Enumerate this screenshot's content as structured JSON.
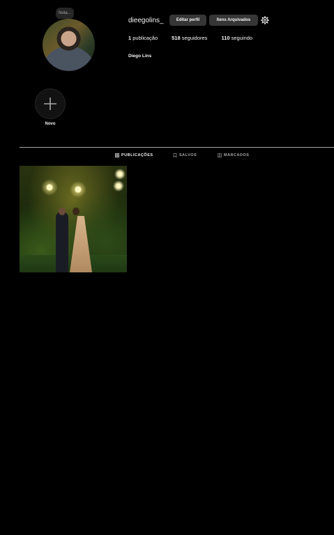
{
  "profile": {
    "note": "Nota...",
    "username": "dieegolins_",
    "full_name": "Diego Lins",
    "buttons": {
      "edit": "Editar perfil",
      "archive": "Itens Arquivados"
    },
    "stats": {
      "posts_count": "1",
      "posts_label": "publicação",
      "followers_count": "518",
      "followers_label": "seguidores",
      "following_count": "110",
      "following_label": "seguindo"
    }
  },
  "highlights": {
    "new_label": "Novo"
  },
  "tabs": [
    {
      "label": "PUBLICAÇÕES",
      "icon": "grid-icon",
      "active": true
    },
    {
      "label": "SALVOS",
      "icon": "bookmark-icon",
      "active": false
    },
    {
      "label": "MARCADOS",
      "icon": "tag-icon",
      "active": false
    }
  ],
  "colors": {
    "background": "#000000",
    "button": "#363636",
    "muted": "#a8a8a8"
  }
}
